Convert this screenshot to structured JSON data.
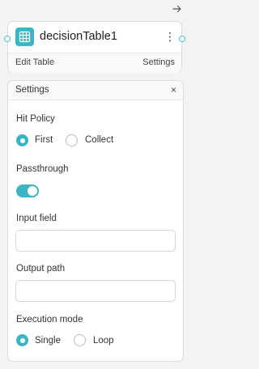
{
  "node": {
    "title": "decisionTable1",
    "menu_glyph": "⋮",
    "footer_left": "Edit Table",
    "footer_right": "Settings",
    "icon": "table-grid-icon",
    "accent": "#3cb5c2"
  },
  "settings": {
    "title": "Settings",
    "close_glyph": "×",
    "hit_policy": {
      "label": "Hit Policy",
      "options": [
        "First",
        "Collect"
      ],
      "selected": "First"
    },
    "passthrough": {
      "label": "Passthrough",
      "enabled": true
    },
    "input_field": {
      "label": "Input field",
      "value": "",
      "placeholder": ""
    },
    "output_path": {
      "label": "Output path",
      "value": "",
      "placeholder": ""
    },
    "execution_mode": {
      "label": "Execution mode",
      "options": [
        "Single",
        "Loop"
      ],
      "selected": "Single"
    }
  }
}
